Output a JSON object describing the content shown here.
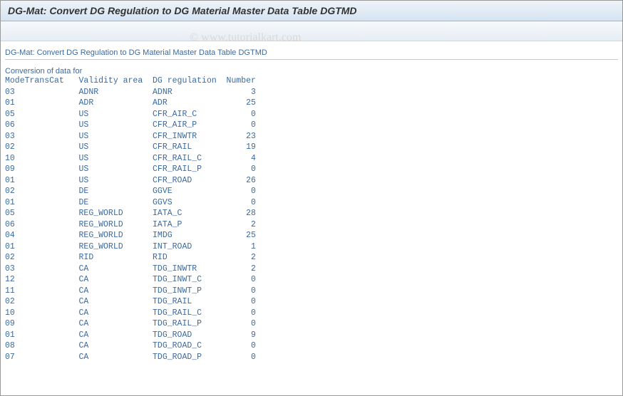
{
  "window": {
    "title": "DG-Mat: Convert DG Regulation to DG Material Master Data Table DGTMD"
  },
  "watermark": "© www.tutorialkart.com",
  "subtitle": "DG-Mat: Convert DG Regulation to DG Material Master Data Table DGTMD",
  "section_label": "Conversion of data for",
  "columns": {
    "mode": "ModeTransCat",
    "validity": "Validity area",
    "regulation": "DG regulation",
    "number": "Number"
  },
  "rows": [
    {
      "mode": "03",
      "validity": "ADNR",
      "regulation": "ADNR",
      "number": 3
    },
    {
      "mode": "01",
      "validity": "ADR",
      "regulation": "ADR",
      "number": 25
    },
    {
      "mode": "05",
      "validity": "US",
      "regulation": "CFR_AIR_C",
      "number": 0
    },
    {
      "mode": "06",
      "validity": "US",
      "regulation": "CFR_AIR_P",
      "number": 0
    },
    {
      "mode": "03",
      "validity": "US",
      "regulation": "CFR_INWTR",
      "number": 23
    },
    {
      "mode": "02",
      "validity": "US",
      "regulation": "CFR_RAIL",
      "number": 19
    },
    {
      "mode": "10",
      "validity": "US",
      "regulation": "CFR_RAIL_C",
      "number": 4
    },
    {
      "mode": "09",
      "validity": "US",
      "regulation": "CFR_RAIL_P",
      "number": 0
    },
    {
      "mode": "01",
      "validity": "US",
      "regulation": "CFR_ROAD",
      "number": 26
    },
    {
      "mode": "02",
      "validity": "DE",
      "regulation": "GGVE",
      "number": 0
    },
    {
      "mode": "01",
      "validity": "DE",
      "regulation": "GGVS",
      "number": 0
    },
    {
      "mode": "05",
      "validity": "REG_WORLD",
      "regulation": "IATA_C",
      "number": 28
    },
    {
      "mode": "06",
      "validity": "REG_WORLD",
      "regulation": "IATA_P",
      "number": 2
    },
    {
      "mode": "04",
      "validity": "REG_WORLD",
      "regulation": "IMDG",
      "number": 25
    },
    {
      "mode": "01",
      "validity": "REG_WORLD",
      "regulation": "INT_ROAD",
      "number": 1
    },
    {
      "mode": "02",
      "validity": "RID",
      "regulation": "RID",
      "number": 2
    },
    {
      "mode": "03",
      "validity": "CA",
      "regulation": "TDG_INWTR",
      "number": 2
    },
    {
      "mode": "12",
      "validity": "CA",
      "regulation": "TDG_INWT_C",
      "number": 0
    },
    {
      "mode": "11",
      "validity": "CA",
      "regulation": "TDG_INWT_P",
      "number": 0
    },
    {
      "mode": "02",
      "validity": "CA",
      "regulation": "TDG_RAIL",
      "number": 0
    },
    {
      "mode": "10",
      "validity": "CA",
      "regulation": "TDG_RAIL_C",
      "number": 0
    },
    {
      "mode": "09",
      "validity": "CA",
      "regulation": "TDG_RAIL_P",
      "number": 0
    },
    {
      "mode": "01",
      "validity": "CA",
      "regulation": "TDG_ROAD",
      "number": 9
    },
    {
      "mode": "08",
      "validity": "CA",
      "regulation": "TDG_ROAD_C",
      "number": 0
    },
    {
      "mode": "07",
      "validity": "CA",
      "regulation": "TDG_ROAD_P",
      "number": 0
    }
  ]
}
